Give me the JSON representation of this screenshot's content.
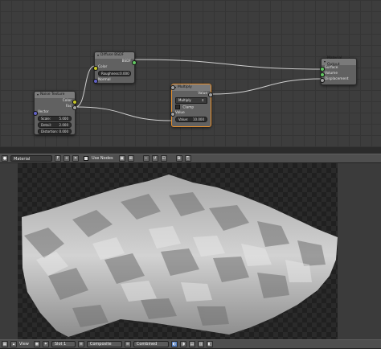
{
  "nodes": {
    "noise_texture": {
      "title": "Noise Texture",
      "outputs": [
        "Color",
        "Fac"
      ],
      "vector_label": "Vector",
      "fields": [
        {
          "label": "Scale:",
          "value": "5.000"
        },
        {
          "label": "Detail:",
          "value": "2.000"
        },
        {
          "label": "Distortion:",
          "value": "0.000"
        }
      ]
    },
    "diffuse_bsdf": {
      "title": "Diffuse BSDF",
      "output": "BSDF",
      "color_label": "Color",
      "roughness": {
        "label": "Roughness:",
        "value": "0.000"
      },
      "normal_label": "Normal"
    },
    "multiply": {
      "title": "Multiply",
      "output": "Value",
      "operation": "Multiply",
      "clamp_label": "Clamp",
      "input_label": "Value",
      "value_field": {
        "label": "Value:",
        "value": "10.000"
      }
    },
    "material_output": {
      "title": "Material Output",
      "inputs": [
        "Surface",
        "Volume",
        "Displacement"
      ]
    }
  },
  "header": {
    "material_name": "Material",
    "fake_user": "F",
    "close": "✕",
    "use_nodes_label": "Use Nodes"
  },
  "footer": {
    "view_label": "View",
    "slot": "Slot 1",
    "composite": "Composite",
    "pass": "Combined"
  },
  "colors": {
    "accent_active": "#e7902d",
    "socket_shader": "#63c763",
    "socket_vector": "#6363c7",
    "socket_color": "#c7c729",
    "socket_value": "#a1a1a1"
  }
}
